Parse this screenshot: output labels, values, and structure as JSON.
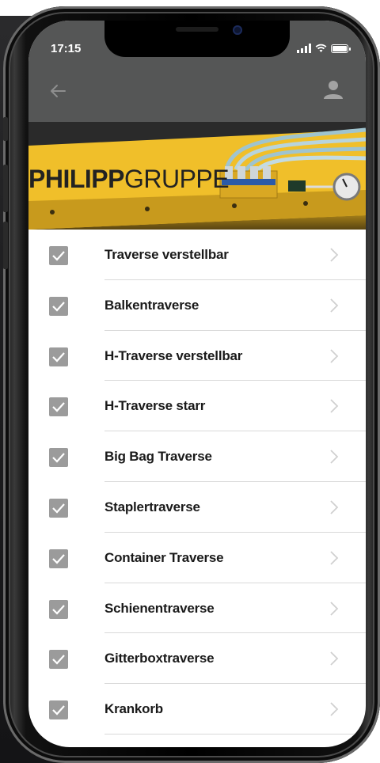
{
  "status_bar": {
    "time": "17:15"
  },
  "nav": {
    "back_icon": "arrow-left-icon",
    "user_icon": "user-icon"
  },
  "banner": {
    "brand_bold": "PHILIPP",
    "brand_light": "GRUPPE"
  },
  "colors": {
    "topbar": "#555656",
    "banner_yellow": "#f2c22c",
    "checkbox": "#9b9b9b",
    "divider": "#d9d9d9"
  },
  "items": [
    {
      "label": "Traverse verstellbar",
      "checked": true
    },
    {
      "label": "Balkentraverse",
      "checked": true
    },
    {
      "label": "H-Traverse verstellbar",
      "checked": true
    },
    {
      "label": "H-Traverse starr",
      "checked": true
    },
    {
      "label": "Big Bag Traverse",
      "checked": true
    },
    {
      "label": "Staplertraverse",
      "checked": true
    },
    {
      "label": "Container Traverse",
      "checked": true
    },
    {
      "label": "Schienentraverse",
      "checked": true
    },
    {
      "label": "Gitterboxtraverse",
      "checked": true
    },
    {
      "label": "Krankorb",
      "checked": true
    }
  ]
}
